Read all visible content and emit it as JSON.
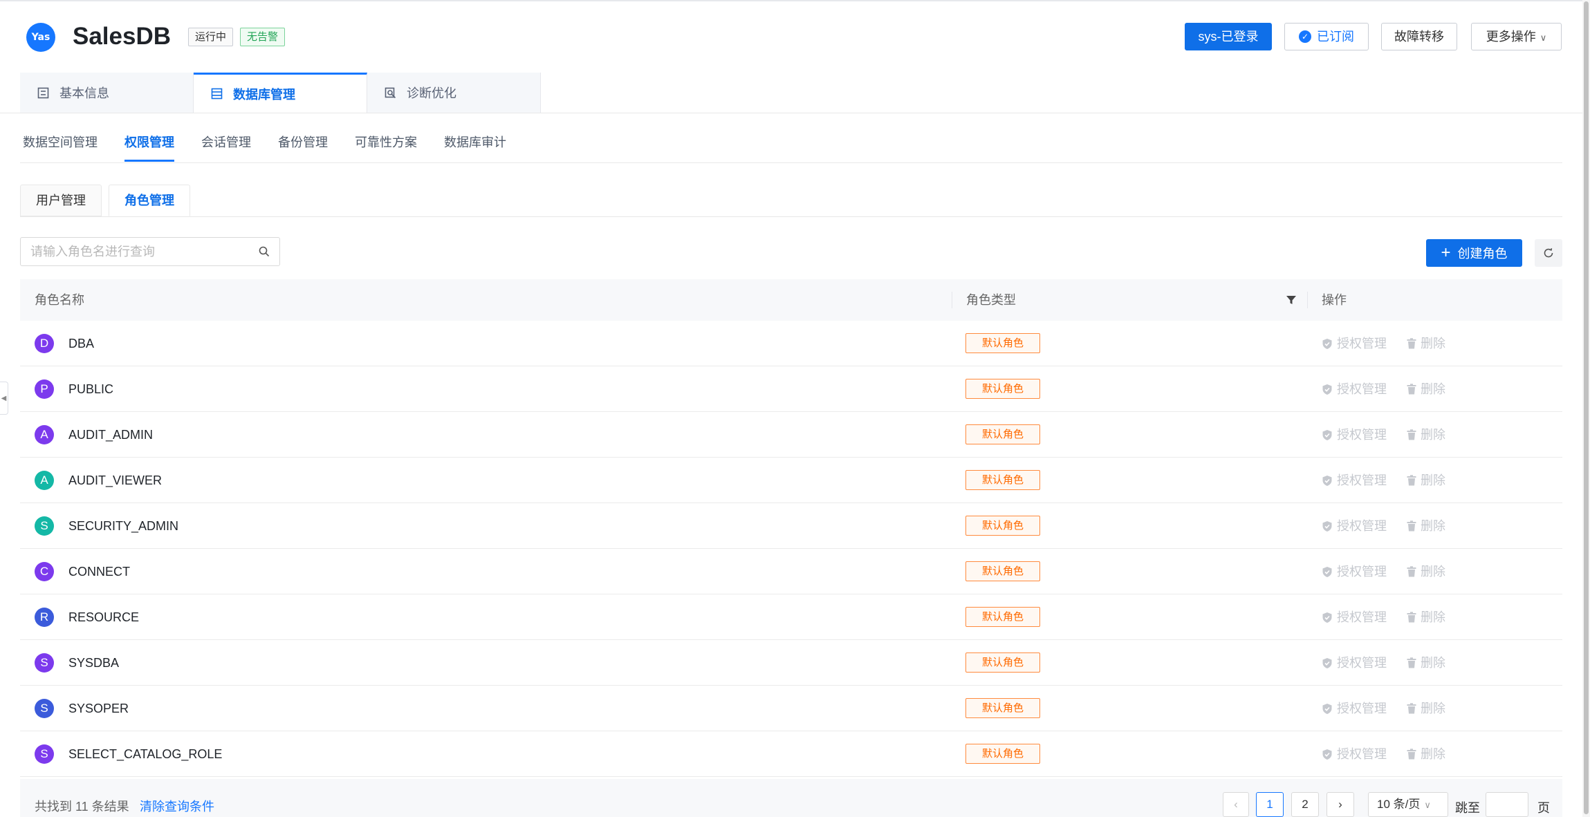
{
  "header": {
    "logo_text": "Yas",
    "title": "SalesDB",
    "status_tag": "运行中",
    "alarm_tag": "无告警",
    "login_button": "sys-已登录",
    "subscribe_button": "已订阅",
    "failover_button": "故障转移",
    "more_button": "更多操作"
  },
  "main_tabs": [
    {
      "label": "基本信息"
    },
    {
      "label": "数据库管理"
    },
    {
      "label": "诊断优化"
    }
  ],
  "sub_tabs": [
    {
      "label": "数据空间管理"
    },
    {
      "label": "权限管理"
    },
    {
      "label": "会话管理"
    },
    {
      "label": "备份管理"
    },
    {
      "label": "可靠性方案"
    },
    {
      "label": "数据库审计"
    }
  ],
  "card_tabs": [
    {
      "label": "用户管理"
    },
    {
      "label": "角色管理"
    }
  ],
  "toolbar": {
    "search_placeholder": "请输入角色名进行查询",
    "create_button": "创建角色"
  },
  "table": {
    "columns": {
      "name": "角色名称",
      "type": "角色类型",
      "op": "操作"
    },
    "grant_label": "授权管理",
    "delete_label": "删除",
    "rows": [
      {
        "initial": "D",
        "name": "DBA",
        "type": "默认角色",
        "color": "#7c3aed"
      },
      {
        "initial": "P",
        "name": "PUBLIC",
        "type": "默认角色",
        "color": "#7c3aed"
      },
      {
        "initial": "A",
        "name": "AUDIT_ADMIN",
        "type": "默认角色",
        "color": "#7c3aed"
      },
      {
        "initial": "A",
        "name": "AUDIT_VIEWER",
        "type": "默认角色",
        "color": "#14b8a6"
      },
      {
        "initial": "S",
        "name": "SECURITY_ADMIN",
        "type": "默认角色",
        "color": "#14b8a6"
      },
      {
        "initial": "C",
        "name": "CONNECT",
        "type": "默认角色",
        "color": "#7c3aed"
      },
      {
        "initial": "R",
        "name": "RESOURCE",
        "type": "默认角色",
        "color": "#3b5bdb"
      },
      {
        "initial": "S",
        "name": "SYSDBA",
        "type": "默认角色",
        "color": "#7c3aed"
      },
      {
        "initial": "S",
        "name": "SYSOPER",
        "type": "默认角色",
        "color": "#3b5bdb"
      },
      {
        "initial": "S",
        "name": "SELECT_CATALOG_ROLE",
        "type": "默认角色",
        "color": "#7c3aed"
      }
    ]
  },
  "footer": {
    "found_text": "共找到 11 条结果",
    "clear_link": "清除查询条件",
    "page_1": "1",
    "page_2": "2",
    "page_size": "10 条/页",
    "jump_label": "跳至",
    "page_label": "页"
  },
  "colors": {
    "primary": "#0f6fe8",
    "tag_orange": "#ff6a00",
    "tag_green": "#20a455"
  }
}
